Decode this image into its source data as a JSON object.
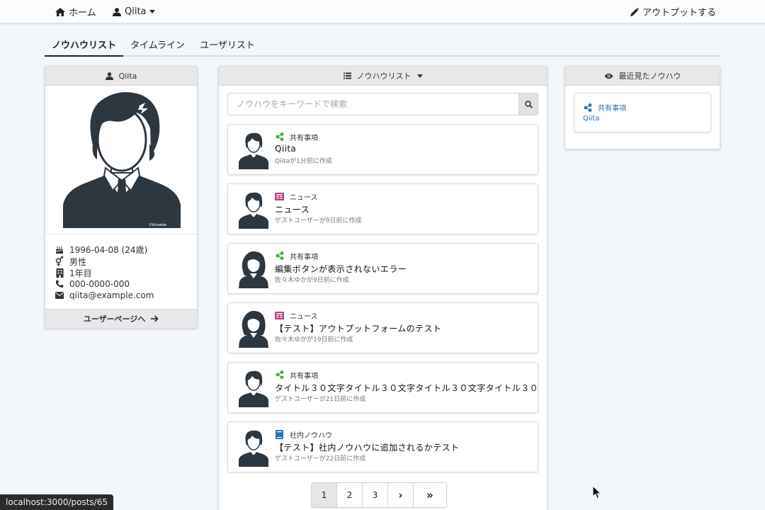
{
  "navbar": {
    "home_label": "ホーム",
    "user_label": "Qiita",
    "output_label": "アウトプットする"
  },
  "tabs": [
    {
      "label": "ノウハウリスト",
      "active": true
    },
    {
      "label": "タイムライン",
      "active": false
    },
    {
      "label": "ユーザリスト",
      "active": false
    }
  ],
  "profile": {
    "header": "Qiita",
    "birthday": "1996-04-08 (24歳)",
    "gender": "男性",
    "years": "1年目",
    "phone": "000-0000-000",
    "email": "qiita@example.com",
    "user_page_button": "ユーザーページへ",
    "watermark": "©Knowbe"
  },
  "knowhow": {
    "header": "ノウハウリスト",
    "search_placeholder": "ノウハウをキーワードで検索",
    "posts": [
      {
        "category": "共有事項",
        "category_icon": "share-icon",
        "category_color": "#3cb043",
        "title": "Qiita",
        "meta": "Qiitaが1分前に作成",
        "avatar": "male"
      },
      {
        "category": "ニュース",
        "category_icon": "newspaper-icon",
        "category_color": "#c2377d",
        "title": "ニュース",
        "meta": "ゲストユーザーが9日前に作成",
        "avatar": "male"
      },
      {
        "category": "共有事項",
        "category_icon": "share-icon",
        "category_color": "#3cb043",
        "title": "編集ボタンが表示されないエラー",
        "meta": "佐々木ゆかが9日前に作成",
        "avatar": "female"
      },
      {
        "category": "ニュース",
        "category_icon": "newspaper-icon",
        "category_color": "#c2377d",
        "title": "【テスト】アウトプットフォームのテスト",
        "meta": "佐々木ゆかが19日前に作成",
        "avatar": "female"
      },
      {
        "category": "共有事項",
        "category_icon": "share-icon",
        "category_color": "#3cb043",
        "title": "タイトル３０文字タイトル３０文字タイトル３０文字タイトル３０",
        "meta": "ゲストユーザーが21日前に作成",
        "avatar": "male"
      },
      {
        "category": "社内ノウハウ",
        "category_icon": "book-icon",
        "category_color": "#2c6fb3",
        "title": "【テスト】社内ノウハウに追加されるかテスト",
        "meta": "ゲストユーザーが22日前に作成",
        "avatar": "male"
      }
    ],
    "pagination": [
      "1",
      "2",
      "3",
      "›",
      "»"
    ],
    "current_page": "1"
  },
  "recent": {
    "header": "最近見たノウハウ",
    "items": [
      {
        "category": "共有事項",
        "title": "Qiita"
      }
    ]
  },
  "statusbar": "localhost:3000/posts/65",
  "colors": {
    "share": "#3cb043",
    "news": "#c2377d",
    "book": "#2c6fb3",
    "link": "#2c6fb3",
    "icon_dark": "#2d3740"
  }
}
